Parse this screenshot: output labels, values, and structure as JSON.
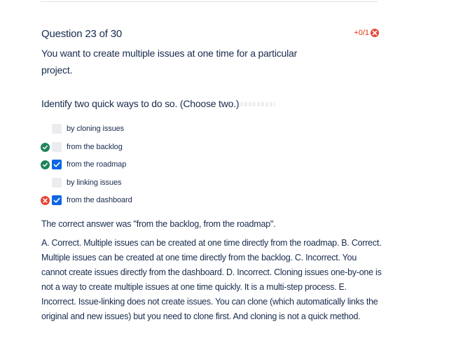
{
  "question": {
    "title": "Question 23 of 30",
    "score": "+0/1",
    "prompt": "You want to create multiple issues at one time for a particular project.",
    "instruction": "Identify two quick ways to do so. (Choose two.)"
  },
  "options": [
    {
      "label": "by cloning issues",
      "checked": false,
      "result": "none"
    },
    {
      "label": "from the backlog",
      "checked": false,
      "result": "correct"
    },
    {
      "label": "from the roadmap",
      "checked": true,
      "result": "correct"
    },
    {
      "label": "by linking issues",
      "checked": false,
      "result": "none"
    },
    {
      "label": "from the dashboard",
      "checked": true,
      "result": "wrong"
    }
  ],
  "feedback": {
    "correct_answer": "The correct answer was \"from the backlog, from the roadmap\".",
    "explanation": "A. Correct. Multiple issues can be created at one time directly from the roadmap. B. Correct. Multiple issues can be created at one time directly from the backlog. C. Incorrect. You cannot create issues directly from the dashboard. D. Incorrect. Cloning issues one-by-one is not a way to create multiple issues at one time quickly. It is a multi-step process. E. Incorrect. Issue-linking does not create issues. You can clone (which automatically links the original and new issues) but you need to clone first. And cloning is not a quick method."
  },
  "colors": {
    "text": "#172b4d",
    "score": "#de350b",
    "correct_icon": "#1f845a",
    "wrong_icon": "#e5493a",
    "checkbox_checked": "#0c66e4",
    "checkbox_unchecked": "#ebecf0"
  },
  "icons": {
    "score": "x-circle-icon",
    "correct": "check-circle-icon",
    "wrong": "x-circle-icon",
    "checked": "checkmark-icon"
  }
}
